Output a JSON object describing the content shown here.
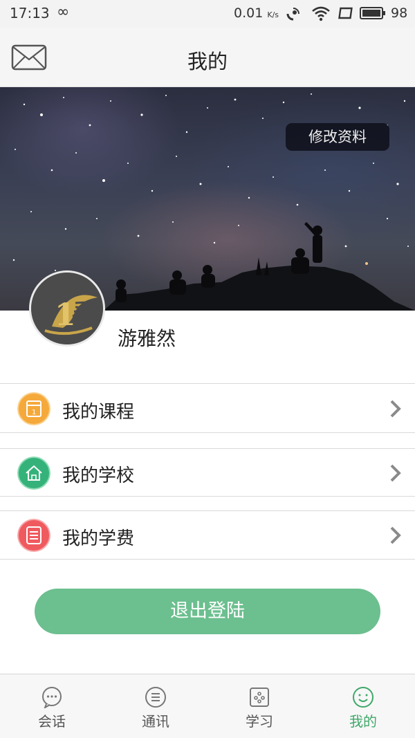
{
  "status_bar": {
    "time": "17:13",
    "infinity": "∞",
    "speed": "0.01",
    "speed_unit": "K/s",
    "battery": "98"
  },
  "header": {
    "title": "我的",
    "mail_icon": "mail-icon"
  },
  "profile": {
    "edit_label": "修改资料",
    "username": "游雅然"
  },
  "menu": {
    "items": [
      {
        "label": "我的课程",
        "icon": "calendar-icon",
        "color": "#f5a93b"
      },
      {
        "label": "我的学校",
        "icon": "home-icon",
        "color": "#35b27a"
      },
      {
        "label": "我的学费",
        "icon": "list-icon",
        "color": "#ef5a5f"
      }
    ]
  },
  "logout": {
    "label": "退出登陆",
    "color": "#6cbf8f"
  },
  "bottom_nav": {
    "items": [
      {
        "label": "会话",
        "icon": "chat-icon",
        "active": false
      },
      {
        "label": "通讯",
        "icon": "contacts-icon",
        "active": false
      },
      {
        "label": "学习",
        "icon": "study-icon",
        "active": false
      },
      {
        "label": "我的",
        "icon": "smile-icon",
        "active": true
      }
    ],
    "active_color": "#3fa86a"
  }
}
